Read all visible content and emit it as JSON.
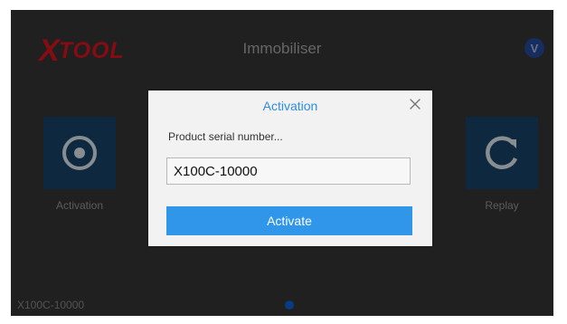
{
  "app": {
    "logo_text": "XTOOL",
    "logo_first_letter": "X",
    "logo_rest": "TOOL",
    "title": "Immobiliser",
    "top_right_icon_text": "V",
    "footer_serial": "X100C-10000"
  },
  "tiles": [
    {
      "label": "Activation",
      "icon": "target-icon"
    },
    {
      "label": "Replay",
      "icon": "refresh-icon"
    }
  ],
  "modal": {
    "title": "Activation",
    "close_icon": "close-icon",
    "field_label": "Product serial number...",
    "input_value": "X100C-10000",
    "button_label": "Activate"
  },
  "colors": {
    "brand_red": "#b0111a",
    "tile_blue": "#123655",
    "accent_blue": "#2f96e9",
    "modal_title_blue": "#2f8ce4",
    "dot_blue": "#0e4eaa"
  }
}
